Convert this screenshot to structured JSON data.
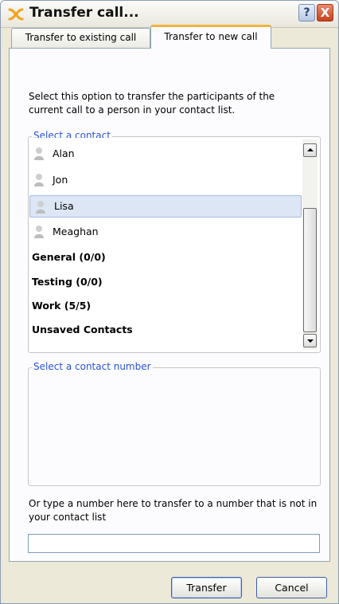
{
  "window": {
    "title": "Transfer call...",
    "help_label": "?",
    "close_label": "X"
  },
  "tabs": [
    {
      "label": "Transfer to existing call",
      "active": false
    },
    {
      "label": "Transfer to new call",
      "active": true
    }
  ],
  "description": "Select this option to transfer the participants of the current call to a person in your contact list.",
  "contact_group": {
    "legend": "Select a contact",
    "contacts": [
      {
        "label": "Alan",
        "selected": false
      },
      {
        "label": "Jon",
        "selected": false
      },
      {
        "label": "Lisa",
        "selected": true
      },
      {
        "label": "Meaghan",
        "selected": false
      }
    ],
    "groups": [
      {
        "label": "General (0/0)"
      },
      {
        "label": "Testing (0/0)"
      },
      {
        "label": "Work (5/5)"
      },
      {
        "label": "Unsaved Contacts"
      }
    ]
  },
  "number_group": {
    "legend": "Select a contact number"
  },
  "hint": "Or type a number here to transfer to a number that is not in your contact list",
  "number_input": {
    "value": ""
  },
  "buttons": {
    "transfer": "Transfer",
    "cancel": "Cancel"
  },
  "colors": {
    "accent": "#2c54d6",
    "selection": "#dce6f4",
    "tab_highlight": "#f2b53b"
  }
}
